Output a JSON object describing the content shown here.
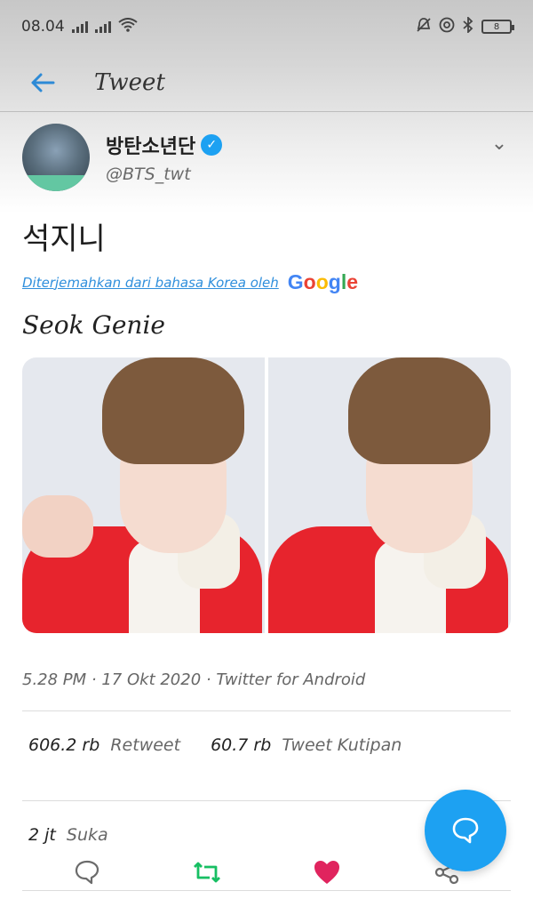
{
  "status": {
    "time": "08.04",
    "battery": "8"
  },
  "header": {
    "title": "Tweet"
  },
  "tweet": {
    "author_name": "방탄소년단",
    "handle": "@BTS_twt",
    "text": "석지니",
    "translation_note": "Diterjemahkan dari bahasa Korea oleh",
    "translation_provider": "Google",
    "translated_text": "Seok Genie",
    "timestamp": "5.28 PM · 17 Okt 2020 · Twitter for Android",
    "retweets_count": "606.2 rb",
    "retweets_label": "Retweet",
    "quotes_count": "60.7 rb",
    "quotes_label": "Tweet Kutipan",
    "likes_count": "2 jt",
    "likes_label": "Suka"
  },
  "icons": {
    "back": "arrow-left-icon",
    "verified": "verified-badge-icon",
    "chevron": "chevron-down-icon",
    "reply": "reply-icon",
    "retweet": "retweet-icon",
    "like": "heart-icon",
    "share": "share-icon",
    "compose": "compose-reply-icon"
  },
  "colors": {
    "accent": "#1da1f2",
    "retweet": "#17bf63",
    "like": "#e0245e"
  }
}
